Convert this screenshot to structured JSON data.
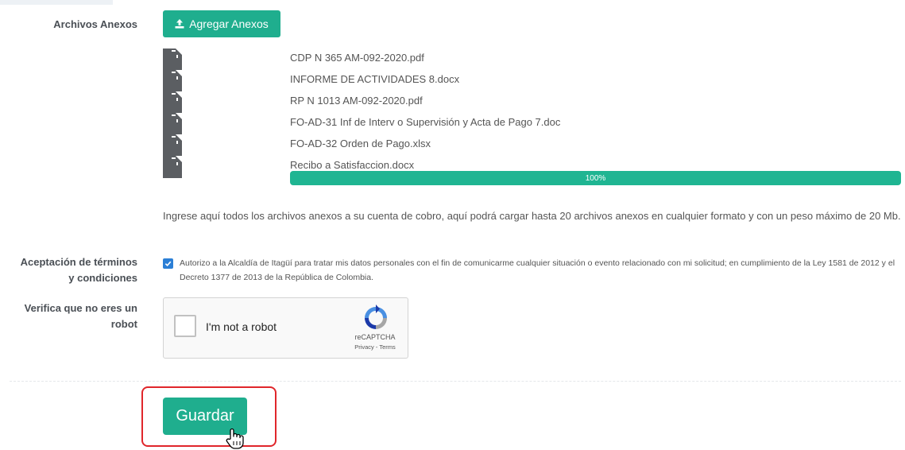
{
  "anexos": {
    "label": "Archivos Anexos",
    "button_label": "Agregar Anexos",
    "files": [
      "CDP N 365 AM-092-2020.pdf",
      "INFORME DE ACTIVIDADES 8.docx",
      "RP N 1013 AM-092-2020.pdf",
      "FO-AD-31 Inf de Interv o Supervisión y Acta de Pago 7.doc",
      "FO-AD-32 Orden de Pago.xlsx",
      "Recibo a Satisfaccion.docx"
    ],
    "progress_label": "100%",
    "progress_fraction": 1.0,
    "help_text": "Ingrese aquí todos los archivos anexos a su cuenta de cobro, aquí podrá cargar hasta 20 archivos anexos en cualquier formato y con un peso máximo de 20 Mb."
  },
  "terms": {
    "label_line1": "Aceptación de términos",
    "label_line2": "y condiciones",
    "checked": true,
    "text": "Autorizo a la Alcaldía de Itagüí para tratar mis datos personales con el fin de comunicarme cualquier situación o evento relacionado con mi solicitud; en cumplimiento de la Ley 1581 de 2012 y el Decreto 1377 de 2013 de la República de Colombia."
  },
  "captcha": {
    "label_line1": "Verifica que no eres un",
    "label_line2": "robot",
    "checkbox_label": "I'm not a robot",
    "brand": "reCAPTCHA",
    "links": "Privacy - Terms"
  },
  "actions": {
    "save_label": "Guardar"
  },
  "colors": {
    "accent": "#1fae8e",
    "file_icon": "#5b5e62",
    "highlight": "#e0262b",
    "checkbox": "#2b7fd6"
  }
}
